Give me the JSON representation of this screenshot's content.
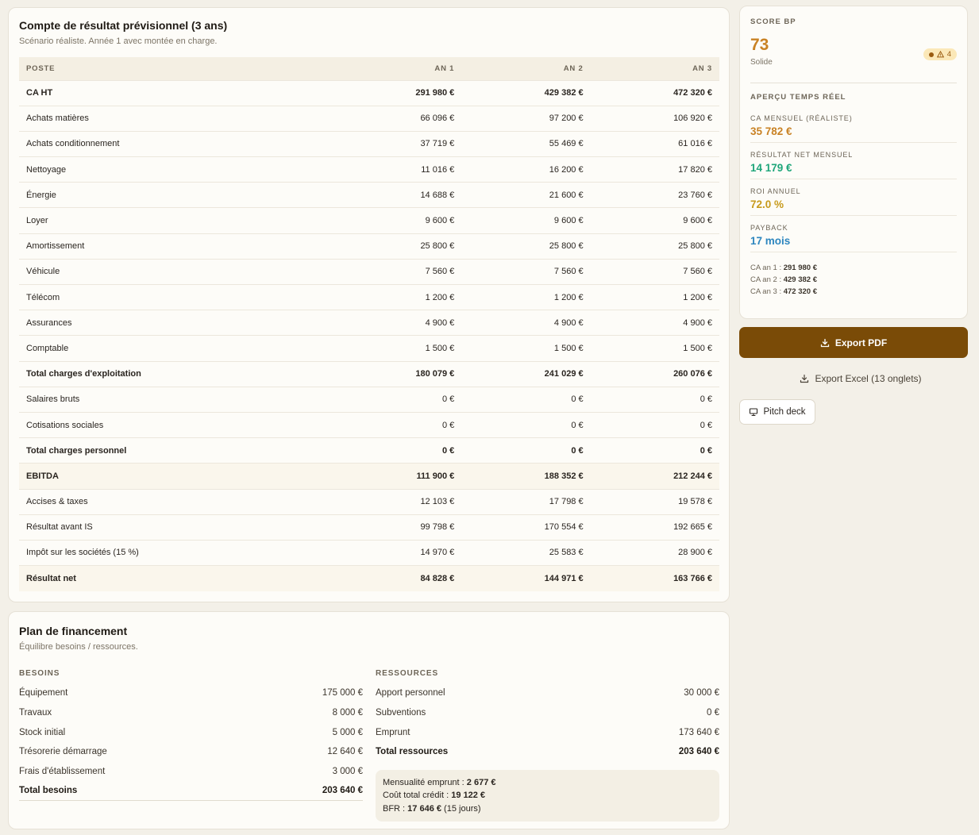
{
  "pnl": {
    "title": "Compte de résultat prévisionnel (3 ans)",
    "subtitle": "Scénario réaliste. Année 1 avec montée en charge.",
    "columns": [
      "POSTE",
      "AN 1",
      "AN 2",
      "AN 3"
    ],
    "rows": [
      {
        "label": "CA HT",
        "v1": "291 980 €",
        "v2": "429 382 €",
        "v3": "472 320 €",
        "style": "bold"
      },
      {
        "label": "Achats matières",
        "v1": "66 096 €",
        "v2": "97 200 €",
        "v3": "106 920 €",
        "style": ""
      },
      {
        "label": "Achats conditionnement",
        "v1": "37 719 €",
        "v2": "55 469 €",
        "v3": "61 016 €",
        "style": ""
      },
      {
        "label": "Nettoyage",
        "v1": "11 016 €",
        "v2": "16 200 €",
        "v3": "17 820 €",
        "style": ""
      },
      {
        "label": "Énergie",
        "v1": "14 688 €",
        "v2": "21 600 €",
        "v3": "23 760 €",
        "style": ""
      },
      {
        "label": "Loyer",
        "v1": "9 600 €",
        "v2": "9 600 €",
        "v3": "9 600 €",
        "style": ""
      },
      {
        "label": "Amortissement",
        "v1": "25 800 €",
        "v2": "25 800 €",
        "v3": "25 800 €",
        "style": ""
      },
      {
        "label": "Véhicule",
        "v1": "7 560 €",
        "v2": "7 560 €",
        "v3": "7 560 €",
        "style": ""
      },
      {
        "label": "Télécom",
        "v1": "1 200 €",
        "v2": "1 200 €",
        "v3": "1 200 €",
        "style": ""
      },
      {
        "label": "Assurances",
        "v1": "4 900 €",
        "v2": "4 900 €",
        "v3": "4 900 €",
        "style": ""
      },
      {
        "label": "Comptable",
        "v1": "1 500 €",
        "v2": "1 500 €",
        "v3": "1 500 €",
        "style": ""
      },
      {
        "label": "Total charges d'exploitation",
        "v1": "180 079 €",
        "v2": "241 029 €",
        "v3": "260 076 €",
        "style": "bold"
      },
      {
        "label": "Salaires bruts",
        "v1": "0 €",
        "v2": "0 €",
        "v3": "0 €",
        "style": ""
      },
      {
        "label": "Cotisations sociales",
        "v1": "0 €",
        "v2": "0 €",
        "v3": "0 €",
        "style": ""
      },
      {
        "label": "Total charges personnel",
        "v1": "0 €",
        "v2": "0 €",
        "v3": "0 €",
        "style": "bold"
      },
      {
        "label": "EBITDA",
        "v1": "111 900 €",
        "v2": "188 352 €",
        "v3": "212 244 €",
        "style": "bold hl"
      },
      {
        "label": "Accises & taxes",
        "v1": "12 103 €",
        "v2": "17 798 €",
        "v3": "19 578 €",
        "style": ""
      },
      {
        "label": "Résultat avant IS",
        "v1": "99 798 €",
        "v2": "170 554 €",
        "v3": "192 665 €",
        "style": ""
      },
      {
        "label": "Impôt sur les sociétés (15 %)",
        "v1": "14 970 €",
        "v2": "25 583 €",
        "v3": "28 900 €",
        "style": ""
      },
      {
        "label": "Résultat net",
        "v1": "84 828 €",
        "v2": "144 971 €",
        "v3": "163 766 €",
        "style": "bold hl"
      }
    ]
  },
  "financing": {
    "title": "Plan de financement",
    "subtitle": "Équilibre besoins / ressources.",
    "needs": {
      "title": "BESOINS",
      "items": [
        {
          "label": "Équipement",
          "value": "175 000 €"
        },
        {
          "label": "Travaux",
          "value": "8 000 €"
        },
        {
          "label": "Stock initial",
          "value": "5 000 €"
        },
        {
          "label": "Trésorerie démarrage",
          "value": "12 640 €"
        },
        {
          "label": "Frais d'établissement",
          "value": "3 000 €"
        }
      ],
      "total_label": "Total besoins",
      "total_value": "203 640 €"
    },
    "resources": {
      "title": "RESSOURCES",
      "items": [
        {
          "label": "Apport personnel",
          "value": "30 000 €"
        },
        {
          "label": "Subventions",
          "value": "0 €"
        },
        {
          "label": "Emprunt",
          "value": "173 640 €"
        }
      ],
      "total_label": "Total ressources",
      "total_value": "203 640 €"
    },
    "loan": {
      "monthly_label": "Mensualité emprunt : ",
      "monthly_value": "2 677 €",
      "cost_label": "Coût total crédit : ",
      "cost_value": "19 122 €",
      "bfr_label": "BFR : ",
      "bfr_value": "17 646 €",
      "bfr_note": " (15 jours)"
    }
  },
  "sidebar": {
    "score_label": "SCORE BP",
    "score_value": "73",
    "score_status": "Solide",
    "warning_count": "4",
    "overview_label": "APERÇU TEMPS RÉEL",
    "metrics": [
      {
        "label": "CA MENSUEL (RÉALISTE)",
        "value": "35 782 €",
        "color": "#c98224"
      },
      {
        "label": "RÉSULTAT NET MENSUEL",
        "value": "14 179 €",
        "color": "#1fa67a"
      },
      {
        "label": "ROI ANNUEL",
        "value": "72.0 %",
        "color": "#c79a1c"
      },
      {
        "label": "PAYBACK",
        "value": "17 mois",
        "color": "#2d86bf"
      }
    ],
    "ca_years": [
      {
        "label": "CA an 1 : ",
        "value": "291 980 €"
      },
      {
        "label": "CA an 2 : ",
        "value": "429 382 €"
      },
      {
        "label": "CA an 3 : ",
        "value": "472 320 €"
      }
    ]
  },
  "actions": {
    "export_pdf": "Export PDF",
    "export_excel": "Export Excel (13 onglets)",
    "pitch_deck": "Pitch deck"
  }
}
